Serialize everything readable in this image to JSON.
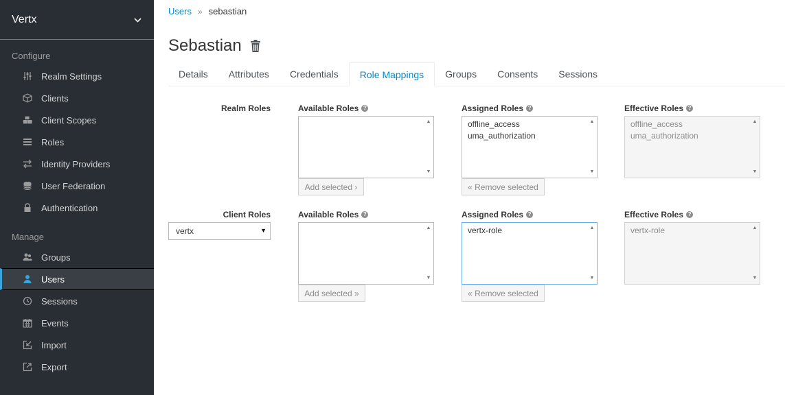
{
  "sidebar": {
    "realm": "Vertx",
    "configure_label": "Configure",
    "manage_label": "Manage",
    "configure_items": [
      {
        "label": "Realm Settings",
        "icon": "sliders-icon"
      },
      {
        "label": "Clients",
        "icon": "cube-icon"
      },
      {
        "label": "Client Scopes",
        "icon": "cubes-icon"
      },
      {
        "label": "Roles",
        "icon": "list-icon"
      },
      {
        "label": "Identity Providers",
        "icon": "exchange-icon"
      },
      {
        "label": "User Federation",
        "icon": "database-icon"
      },
      {
        "label": "Authentication",
        "icon": "lock-icon"
      }
    ],
    "manage_items": [
      {
        "label": "Groups",
        "icon": "users-icon"
      },
      {
        "label": "Users",
        "icon": "user-icon"
      },
      {
        "label": "Sessions",
        "icon": "clock-icon"
      },
      {
        "label": "Events",
        "icon": "calendar-icon"
      },
      {
        "label": "Import",
        "icon": "import-icon"
      },
      {
        "label": "Export",
        "icon": "export-icon"
      }
    ],
    "active_item": "Users"
  },
  "breadcrumb": {
    "parent": "Users",
    "separator": "»",
    "current": "sebastian"
  },
  "page": {
    "title": "Sebastian"
  },
  "tabs": [
    "Details",
    "Attributes",
    "Credentials",
    "Role Mappings",
    "Groups",
    "Consents",
    "Sessions"
  ],
  "active_tab": "Role Mappings",
  "realm_roles": {
    "row_label": "Realm Roles",
    "available_header": "Available Roles",
    "assigned_header": "Assigned Roles",
    "effective_header": "Effective Roles",
    "available": [],
    "assigned": [
      "offline_access",
      "uma_authorization"
    ],
    "effective": [
      "offline_access",
      "uma_authorization"
    ],
    "add_button": "Add selected ›",
    "remove_button": "« Remove selected"
  },
  "client_roles": {
    "row_label": "Client Roles",
    "client_value": "vertx",
    "available_header": "Available Roles",
    "assigned_header": "Assigned Roles",
    "effective_header": "Effective Roles",
    "available": [],
    "assigned": [
      "vertx-role"
    ],
    "effective": [
      "vertx-role"
    ],
    "add_button": "Add selected »",
    "remove_button": "« Remove selected"
  },
  "colors": {
    "sidebar_bg": "#292e34",
    "accent": "#0088ce",
    "active_border": "#39a5dc"
  }
}
